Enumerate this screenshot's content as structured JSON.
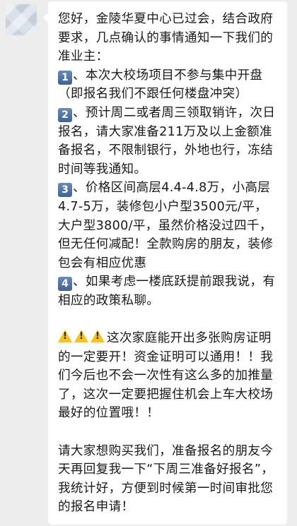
{
  "message": {
    "intro": "您好，金陵华夏中心已过会，结合政府要求，几点确认的事情通知一下我们的准业主：",
    "items": [
      {
        "badge": "1",
        "text": "、本次大校场项目不参与集中开盘（即报名我们不跟任何楼盘冲突）"
      },
      {
        "badge": "2",
        "text": "、预计周二或者周三领取销许，次日报名，请大家准备211万及以上金额准备报名，不限制银行，外地也行，冻结时间等我通知。"
      },
      {
        "badge": "3",
        "text": "、价格区间高层4.4-4.8万，小高层4.7-5万，装修包小户型3500元/平，大户型3800/平，虽然价格没过四千，但无任何减配！全款购房的朋友，装修包会有相应优惠"
      },
      {
        "badge": "4",
        "text": "、如果考虑一楼底跃提前跟我说，有相应的政策私聊。"
      }
    ],
    "warning_icons": [
      "warning-icon",
      "warning-icon",
      "warning-icon"
    ],
    "warning_text": "这次家庭能开出多张购房证明的一定要开！资金证明可以通用！！我们今后也不会一次性有这么多的加推量了，这次一定要把握住机会上车大校场最好的位置哦！！",
    "closing": "请大家想购买我们，准备报名的朋友今天再回复我一下“下周三准备好报名”，我统计好，方便到时候第一时间审批您的报名申请！"
  },
  "colors": {
    "background": "#ededed",
    "bubble": "#ffffff",
    "text": "#1a1a1a",
    "number_badge": "#4f72a6",
    "warning": "#f3c12a"
  }
}
